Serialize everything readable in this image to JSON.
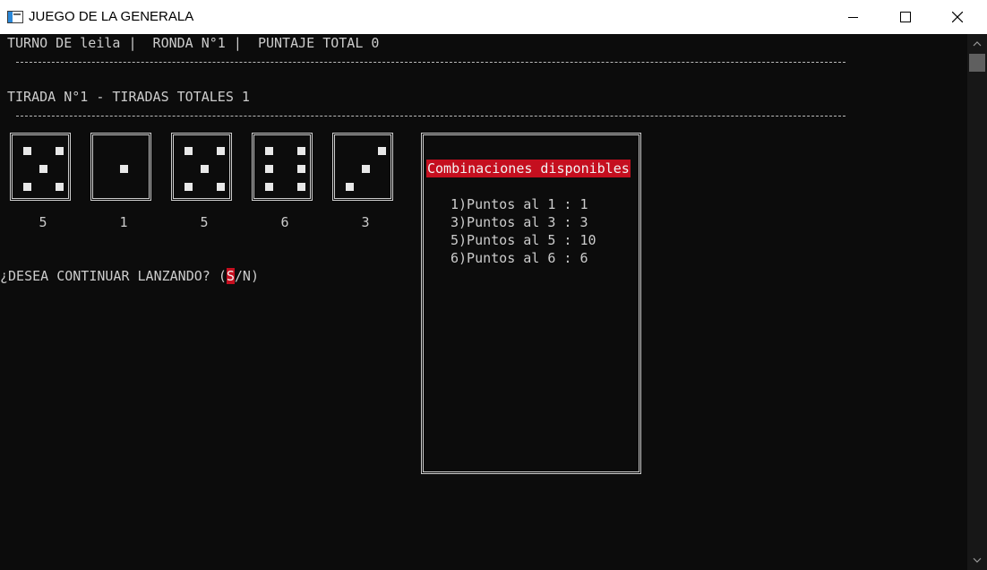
{
  "window": {
    "title": "JUEGO DE LA GENERALA",
    "icon": "console-app-icon",
    "controls": [
      "minimize-icon",
      "maximize-icon",
      "close-icon"
    ]
  },
  "status": {
    "turn_line": "TURNO DE leila |  RONDA N°1 |  PUNTAJE TOTAL 0",
    "throw_line": "TIRADA N°1 - TIRADAS TOTALES 1"
  },
  "dice": [
    {
      "value": "5"
    },
    {
      "value": "1"
    },
    {
      "value": "5"
    },
    {
      "value": "6"
    },
    {
      "value": "3"
    }
  ],
  "combinations": {
    "header": "Combinaciones disponibles",
    "items": [
      "1)Puntos al 1 : 1",
      "3)Puntos al 3 : 3",
      "5)Puntos al 5 : 10",
      "6)Puntos al 6 : 6"
    ]
  },
  "prompt": {
    "prefix": "¿DESEA CONTINUAR LANZANDO? (",
    "highlight": "S",
    "suffix": "/N)"
  },
  "colors": {
    "background": "#0c0c0c",
    "text": "#cccccc",
    "highlight": "#c50f1f"
  }
}
